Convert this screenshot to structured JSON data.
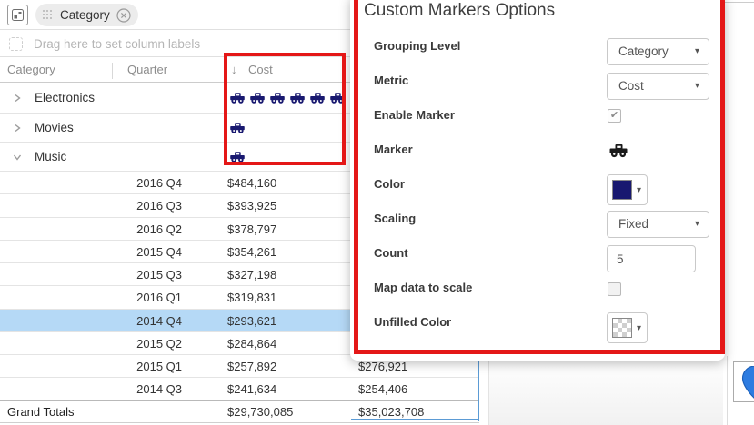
{
  "colors": {
    "marker_navy": "#191970",
    "row_highlight": "#b5d9f6",
    "table_selection_blue": "#5b9bd5",
    "annotation_red": "#e41717",
    "pin_blue": "#2d7ce1"
  },
  "toolbar": {
    "pivot_icon": "pivot-table-icon",
    "chip": {
      "label": "Category",
      "drag_icon": "drag-handle-icon",
      "close_icon": "close-icon"
    }
  },
  "column_zone": {
    "placeholder": "Drag here to set column labels",
    "icon": "column-drop-icon"
  },
  "table": {
    "headers": [
      "Category",
      "Quarter",
      "Cost"
    ],
    "sort_icon": "↓",
    "category_rows": [
      {
        "label": "Electronics",
        "state": "collapsed",
        "marker_count": 6
      },
      {
        "label": "Movies",
        "state": "collapsed",
        "marker_count": 1
      },
      {
        "label": "Music",
        "state": "expanded",
        "marker_count": 1
      }
    ],
    "quarter_rows": [
      {
        "quarter": "2016 Q4",
        "cost": "$484,160",
        "col2": "",
        "highlighted": false
      },
      {
        "quarter": "2016 Q3",
        "cost": "$393,925",
        "col2": "",
        "highlighted": false
      },
      {
        "quarter": "2016 Q2",
        "cost": "$378,797",
        "col2": "",
        "highlighted": false
      },
      {
        "quarter": "2015 Q4",
        "cost": "$354,261",
        "col2": "",
        "highlighted": false
      },
      {
        "quarter": "2015 Q3",
        "cost": "$327,198",
        "col2": "",
        "highlighted": false
      },
      {
        "quarter": "2016 Q1",
        "cost": "$319,831",
        "col2": "",
        "highlighted": false
      },
      {
        "quarter": "2014 Q4",
        "cost": "$293,621",
        "col2": "",
        "highlighted": true
      },
      {
        "quarter": "2015 Q2",
        "cost": "$284,864",
        "col2": "",
        "highlighted": false
      },
      {
        "quarter": "2015 Q1",
        "cost": "$257,892",
        "col2": "$276,921",
        "highlighted": false
      },
      {
        "quarter": "2014 Q3",
        "cost": "$241,634",
        "col2": "$254,406",
        "highlighted": false
      }
    ],
    "grand_totals": {
      "label": "Grand Totals",
      "cost": "$29,730,085",
      "col2": "$35,023,708"
    }
  },
  "dialog": {
    "title": "Custom Markers Options",
    "check_glyph": "✔",
    "caret_glyph": "▾",
    "fields": [
      {
        "label": "Grouping Level",
        "type": "select",
        "value": "Category"
      },
      {
        "label": "Metric",
        "type": "select",
        "value": "Cost"
      },
      {
        "label": "Enable Marker",
        "type": "checkbox",
        "checked": true
      },
      {
        "label": "Marker",
        "type": "icon",
        "icon": "truck-marker-icon"
      },
      {
        "label": "Color",
        "type": "color",
        "value": "#191970"
      },
      {
        "label": "Scaling",
        "type": "select",
        "value": "Fixed"
      },
      {
        "label": "Count",
        "type": "input",
        "value": "5"
      },
      {
        "label": "Map data to scale",
        "type": "checkbox",
        "checked": false
      },
      {
        "label": "Unfilled Color",
        "type": "color",
        "value": "transparent-checker"
      }
    ]
  }
}
